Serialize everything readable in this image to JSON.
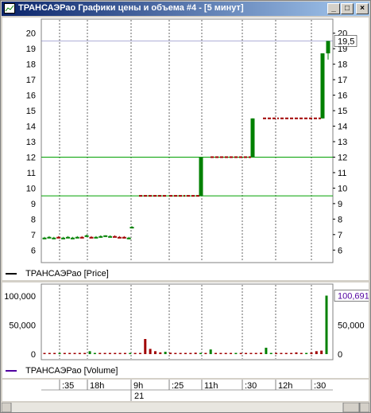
{
  "window": {
    "title": "ТРАНСАЭРао Графики цены и объема #4 - [5 минут]",
    "buttons": {
      "minimize": "_",
      "maximize": "□",
      "close": "×"
    }
  },
  "price_panel": {
    "legend_label": "ТРАНСАЭРао [Price]",
    "y_ticks": [
      "20",
      "19",
      "18",
      "17",
      "16",
      "15",
      "14",
      "13",
      "12",
      "11",
      "10",
      "9",
      "8",
      "7",
      "6"
    ],
    "last_value_label": "19,5"
  },
  "volume_panel": {
    "legend_label": "ТРАНСАЭРао [Volume]",
    "y_ticks_left": [
      "100,000",
      "50,000",
      "0"
    ],
    "y_ticks_right": [
      "50,000",
      "0"
    ],
    "last_value_label": "100,691"
  },
  "time_axis": {
    "labels": [
      ":35",
      "18h",
      "9h",
      ":25",
      "11h",
      ":30",
      "12h",
      ":30"
    ],
    "date_label": "21"
  },
  "colors": {
    "up": "#008000",
    "down": "#a00000",
    "level_line": "#00a000",
    "grid": "#000000",
    "accent": "#000080"
  },
  "chart_data": [
    {
      "type": "candlestick",
      "title": "ТРАНСАЭРао [Price]",
      "ylim": [
        5.5,
        20.5
      ],
      "x_tick_labels": [
        ":35",
        "18h",
        "9h",
        ":25",
        "11h",
        ":30",
        "12h",
        ":30"
      ],
      "horizontal_lines": [
        12,
        9.5
      ],
      "series": [
        {
          "name": "ТРАНСАЭРао [Price]",
          "values": [
            {
              "o": 6.8,
              "h": 6.85,
              "l": 6.75,
              "c": 6.8
            },
            {
              "o": 6.85,
              "h": 6.9,
              "l": 6.8,
              "c": 6.85
            },
            {
              "o": 6.8,
              "h": 6.85,
              "l": 6.75,
              "c": 6.8
            },
            {
              "o": 6.85,
              "h": 6.9,
              "l": 6.8,
              "c": 6.8
            },
            {
              "o": 6.8,
              "h": 6.85,
              "l": 6.75,
              "c": 6.8
            },
            {
              "o": 6.85,
              "h": 6.9,
              "l": 6.8,
              "c": 6.85
            },
            {
              "o": 6.8,
              "h": 6.85,
              "l": 6.75,
              "c": 6.8
            },
            {
              "o": 6.85,
              "h": 6.9,
              "l": 6.8,
              "c": 6.85
            },
            {
              "o": 6.85,
              "h": 6.9,
              "l": 6.8,
              "c": 6.8
            },
            {
              "o": 6.9,
              "h": 7.0,
              "l": 6.85,
              "c": 6.95
            },
            {
              "o": 6.85,
              "h": 6.9,
              "l": 6.8,
              "c": 6.8
            },
            {
              "o": 6.85,
              "h": 6.9,
              "l": 6.8,
              "c": 6.85
            },
            {
              "o": 6.85,
              "h": 6.95,
              "l": 6.8,
              "c": 6.9
            },
            {
              "o": 6.9,
              "h": 6.95,
              "l": 6.85,
              "c": 6.95
            },
            {
              "o": 6.9,
              "h": 6.95,
              "l": 6.85,
              "c": 6.9
            },
            {
              "o": 6.9,
              "h": 6.95,
              "l": 6.85,
              "c": 6.85
            },
            {
              "o": 6.85,
              "h": 6.9,
              "l": 6.8,
              "c": 6.8
            },
            {
              "o": 6.85,
              "h": 6.9,
              "l": 6.75,
              "c": 6.8
            },
            {
              "o": 6.8,
              "h": 6.85,
              "l": 6.75,
              "c": 6.8
            },
            {
              "o": 7.5,
              "h": 7.55,
              "l": 7.45,
              "c": 7.5
            },
            {
              "o": 9.5,
              "h": 9.5,
              "l": 9.5,
              "c": 9.5
            },
            {
              "o": 9.5,
              "h": 9.5,
              "l": 9.5,
              "c": 9.5
            },
            {
              "o": 9.5,
              "h": 9.5,
              "l": 9.5,
              "c": 9.5
            },
            {
              "o": 9.5,
              "h": 9.5,
              "l": 9.5,
              "c": 9.5
            },
            {
              "o": 9.5,
              "h": 12.0,
              "l": 9.5,
              "c": 12.0
            },
            {
              "o": 12.0,
              "h": 12.0,
              "l": 12.0,
              "c": 12.0
            },
            {
              "o": 12.0,
              "h": 12.0,
              "l": 12.0,
              "c": 12.0
            },
            {
              "o": 12.0,
              "h": 12.0,
              "l": 12.0,
              "c": 12.0
            },
            {
              "o": 12.0,
              "h": 14.5,
              "l": 12.0,
              "c": 14.5
            },
            {
              "o": 14.5,
              "h": 14.5,
              "l": 14.5,
              "c": 14.5
            },
            {
              "o": 14.5,
              "h": 14.5,
              "l": 14.5,
              "c": 14.5
            },
            {
              "o": 14.5,
              "h": 14.5,
              "l": 14.5,
              "c": 14.5
            },
            {
              "o": 14.5,
              "h": 18.7,
              "l": 14.5,
              "c": 18.7
            },
            {
              "o": 18.7,
              "h": 19.5,
              "l": 18.3,
              "c": 19.5
            }
          ]
        }
      ]
    },
    {
      "type": "bar",
      "title": "ТРАНСАЭРао [Volume]",
      "ylim": [
        0,
        110000
      ],
      "x_tick_labels": [
        ":35",
        "18h",
        "9h",
        ":25",
        "11h",
        ":30",
        "12h",
        ":30"
      ],
      "series": [
        {
          "name": "ТРАНСАЭРао [Volume]",
          "values": [
            300,
            200,
            400,
            300,
            200,
            600,
            300,
            400,
            500,
            5000,
            300,
            400,
            800,
            600,
            400,
            300,
            500,
            800,
            400,
            1500,
            26000,
            9000,
            5000,
            3000,
            4000,
            2500,
            2000,
            2000,
            1500,
            2000,
            2500,
            2000,
            1500,
            8000,
            2000,
            1000,
            1500,
            1000,
            1500,
            2000,
            1500,
            1000,
            2000,
            2500,
            11000,
            2000,
            1500,
            1000,
            1500,
            2000,
            3000,
            2000,
            1500,
            3000,
            5000,
            6000,
            100691
          ]
        }
      ]
    }
  ]
}
